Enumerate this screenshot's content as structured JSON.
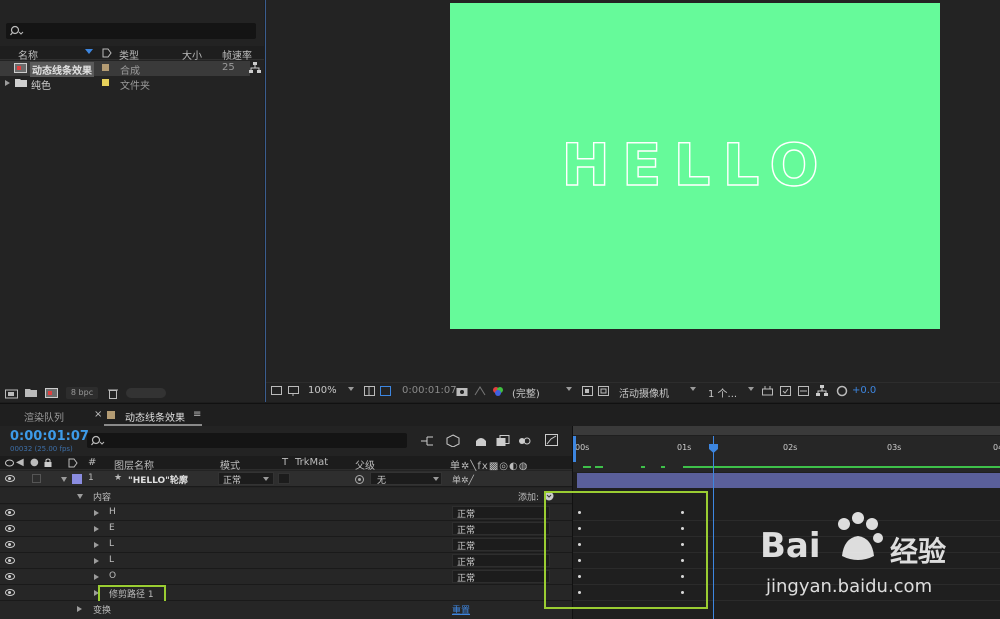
{
  "project": {
    "columns": {
      "name": "名称",
      "type": "类型",
      "size": "大小",
      "fps": "帧速率"
    },
    "items": [
      {
        "name": "动态线条效果",
        "type": "合成",
        "fps": "25",
        "color": "#b39b73"
      },
      {
        "name": "纯色",
        "type": "文件夹",
        "color": "#e6d05a"
      }
    ],
    "footer_bpc": "8 bpc"
  },
  "viewer": {
    "canvas_text": "HELLO",
    "canvas_color": "#66fa9a",
    "zoom": "100%",
    "timecode": "0:00:01:07",
    "resolution": "(完整)",
    "camera": "活动摄像机",
    "views": "1 个...",
    "exposure": "+0.0"
  },
  "timeline": {
    "tabs": {
      "render_queue": "渲染队列",
      "comp": "动态线条效果"
    },
    "timecode": "0:00:01:07",
    "frame_info": "00032 (25.00 fps)",
    "headers": {
      "num": "#",
      "layer_name": "图层名称",
      "mode": "模式",
      "t": "T",
      "trkmat": "TrkMat",
      "parent": "父级"
    },
    "layer": {
      "num": "1",
      "name": "\"HELLO\"轮廓",
      "mode": "正常",
      "parent": "无"
    },
    "content_label": "内容",
    "add_label": "添加:",
    "shapes": [
      {
        "name": "H",
        "mode": "正常"
      },
      {
        "name": "E",
        "mode": "正常"
      },
      {
        "name": "L",
        "mode": "正常"
      },
      {
        "name": "L",
        "mode": "正常"
      },
      {
        "name": "O",
        "mode": "正常"
      }
    ],
    "trim_paths": "修剪路径 1",
    "transform": "变换",
    "reset": "重置",
    "ruler": [
      "00s",
      "01s",
      "02s",
      "03s",
      "04"
    ],
    "highlight_color": "#9acd32"
  },
  "watermark": {
    "brand": "Bai",
    "brand2": "经验",
    "url": "jingyan.baidu.com"
  }
}
